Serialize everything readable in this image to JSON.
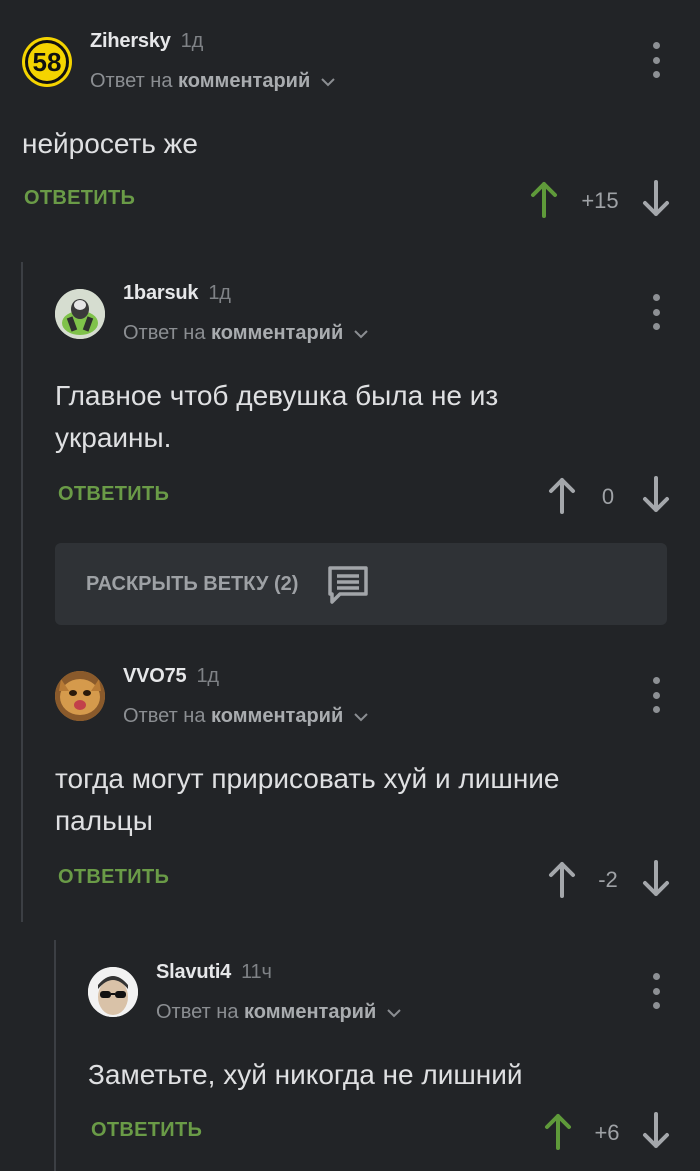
{
  "comments": [
    {
      "username": "Zihersky",
      "time": "1д",
      "reply_prefix": "Ответ на",
      "reply_target": "комментарий",
      "text_lines": [
        "нейросеть же"
      ],
      "reply_label": "ОТВЕТИТЬ",
      "score": "+15",
      "avatar_badge": "58",
      "vote_up_color": "#5f9a3a"
    },
    {
      "username": "1barsuk",
      "time": "1д",
      "reply_prefix": "Ответ на",
      "reply_target": "комментарий",
      "text_lines": [
        "Главное чтоб девушка была не из",
        "украины."
      ],
      "reply_label": "ОТВЕТИТЬ",
      "score": "0",
      "vote_up_color": "#a4a7ab"
    },
    {
      "username": "VVO75",
      "time": "1д",
      "reply_prefix": "Ответ на",
      "reply_target": "комментарий",
      "text_lines": [
        "тогда могут пририсовать хуй и лишние",
        "пальцы"
      ],
      "reply_label": "ОТВЕТИТЬ",
      "score": "-2",
      "vote_up_color": "#a4a7ab"
    },
    {
      "username": "Slavuti4",
      "time": "11ч",
      "reply_prefix": "Ответ на",
      "reply_target": "комментарий",
      "text_lines": [
        "Заметьте, хуй никогда не лишний"
      ],
      "reply_label": "ОТВЕТИТЬ",
      "score": "+6",
      "vote_up_color": "#5f9a3a"
    }
  ],
  "expand_branch": {
    "label": "РАСКРЫТЬ ВЕТКУ (2)",
    "icon": "comment-bubble-icon"
  },
  "colors": {
    "background": "#222427",
    "accent_green": "#6a9b47",
    "thread_line": "#3c3f44"
  }
}
